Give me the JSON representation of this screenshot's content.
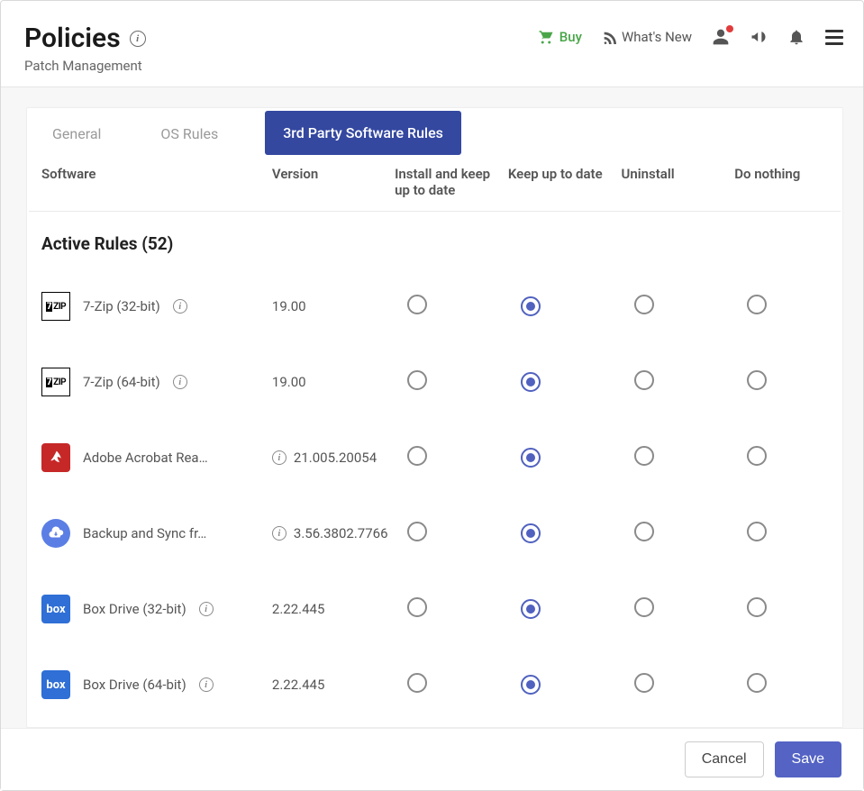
{
  "header": {
    "title": "Policies",
    "subtitle": "Patch Management",
    "buy": "Buy",
    "whatsnew": "What's New"
  },
  "tabs": {
    "general": "General",
    "osrules": "OS Rules",
    "thirdparty": "3rd Party Software Rules"
  },
  "columns": {
    "software": "Software",
    "version": "Version",
    "install": "Install and keep up to date",
    "keep": "Keep up to date",
    "uninstall": "Uninstall",
    "nothing": "Do nothing"
  },
  "section_label": "Active Rules (52)",
  "rows": [
    {
      "icon": "7zip",
      "name": "7-Zip (32-bit)",
      "version": "19.00",
      "info_before_ver": false,
      "selected": "keep"
    },
    {
      "icon": "7zip",
      "name": "7-Zip (64-bit)",
      "version": "19.00",
      "info_before_ver": false,
      "selected": "keep"
    },
    {
      "icon": "adobe",
      "name": "Adobe Acrobat Rea…",
      "version": "21.005.20054",
      "info_before_ver": true,
      "selected": "keep"
    },
    {
      "icon": "gsync",
      "name": "Backup and Sync fr…",
      "version": "3.56.3802.7766",
      "info_before_ver": true,
      "selected": "keep"
    },
    {
      "icon": "box",
      "name": "Box Drive (32-bit)",
      "version": "2.22.445",
      "info_before_ver": false,
      "selected": "keep"
    },
    {
      "icon": "box",
      "name": "Box Drive (64-bit)",
      "version": "2.22.445",
      "info_before_ver": false,
      "selected": "keep"
    }
  ],
  "footer": {
    "cancel": "Cancel",
    "save": "Save"
  }
}
